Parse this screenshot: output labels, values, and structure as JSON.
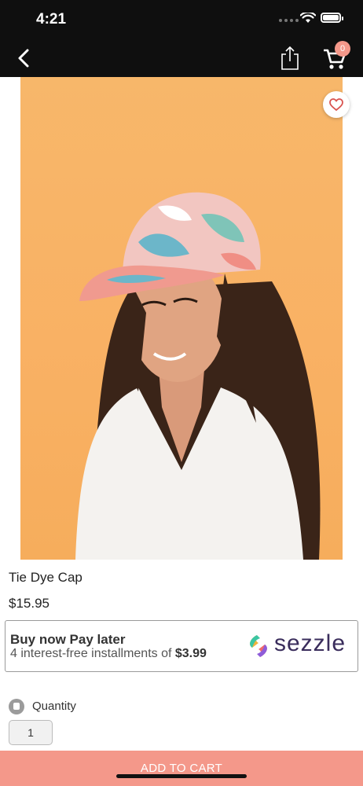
{
  "status_bar": {
    "time": "4:21"
  },
  "nav": {
    "cart_count": "0"
  },
  "product": {
    "title": "Tie Dye Cap",
    "price": "$15.95"
  },
  "sezzle": {
    "headline": "Buy now Pay later",
    "installments_prefix": "4 interest-free installments of ",
    "installment_amount": "$3.99",
    "brand": "sezzle"
  },
  "quantity": {
    "label": "Quantity",
    "value": "1"
  },
  "actions": {
    "add_to_cart": "ADD TO CART"
  },
  "colors": {
    "accent": "#f4988a",
    "nav_bg": "#0f0f0f",
    "photo_bg": "#f7b56a"
  },
  "icons": [
    "back-arrow-icon",
    "share-icon",
    "cart-icon",
    "heart-icon",
    "quantity-icon"
  ]
}
